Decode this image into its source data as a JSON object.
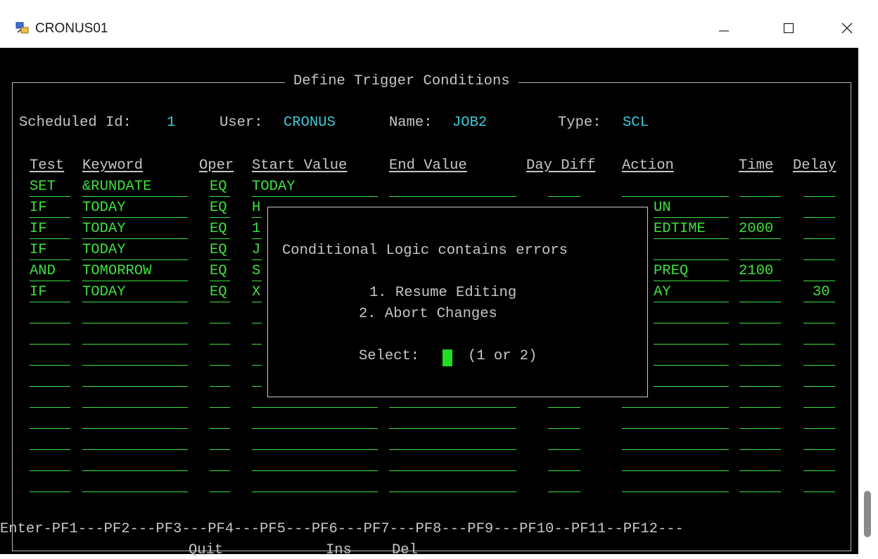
{
  "window": {
    "title": "CRONUS01",
    "icon": "terminal-app-icon",
    "controls": [
      "minimize",
      "maximize",
      "close"
    ]
  },
  "screen": {
    "heading": "Define Trigger Conditions",
    "scheduled_id_label": "Scheduled Id:",
    "scheduled_id": "1",
    "user_label": "User:",
    "user": "CRONUS",
    "name_label": "Name:",
    "name": "JOB2",
    "type_label": "Type:",
    "type": "SCL"
  },
  "columns": [
    "Test",
    "Keyword",
    "Oper",
    "Start Value",
    "End Value",
    "Day Diff",
    "Action",
    "Time",
    "Delay"
  ],
  "rows": [
    {
      "test": "SET",
      "keyword": "&RUNDATE",
      "oper": "EQ",
      "start": "TODAY",
      "action": "",
      "time": "",
      "delay": ""
    },
    {
      "test": "IF",
      "keyword": "TODAY",
      "oper": "EQ",
      "start": "H",
      "action": "UN",
      "time": "",
      "delay": ""
    },
    {
      "test": "IF",
      "keyword": "TODAY",
      "oper": "EQ",
      "start": "1",
      "action": "EDTIME",
      "time": "2000",
      "delay": ""
    },
    {
      "test": "IF",
      "keyword": "TODAY",
      "oper": "EQ",
      "start": "J",
      "action": "",
      "time": "",
      "delay": ""
    },
    {
      "test": "AND",
      "keyword": "TOMORROW",
      "oper": "EQ",
      "start": "S",
      "action": "PREQ",
      "time": "2100",
      "delay": ""
    },
    {
      "test": "IF",
      "keyword": "TODAY",
      "oper": "EQ",
      "start": "X",
      "action": "AY",
      "time": "",
      "delay": "30"
    }
  ],
  "popup": {
    "message": "Conditional Logic contains errors",
    "option1": "1. Resume Editing",
    "option2": "2. Abort Changes",
    "select_label": "Select:",
    "select_hint": "(1 or 2)"
  },
  "footer": {
    "keys_line": "Enter-PF1---PF2---PF3---PF4---PF5---PF6---PF7---PF8---PF9---PF10--PF11--PF12---",
    "pf3": "Quit",
    "pf5": "Ins",
    "pf6": "Del"
  }
}
